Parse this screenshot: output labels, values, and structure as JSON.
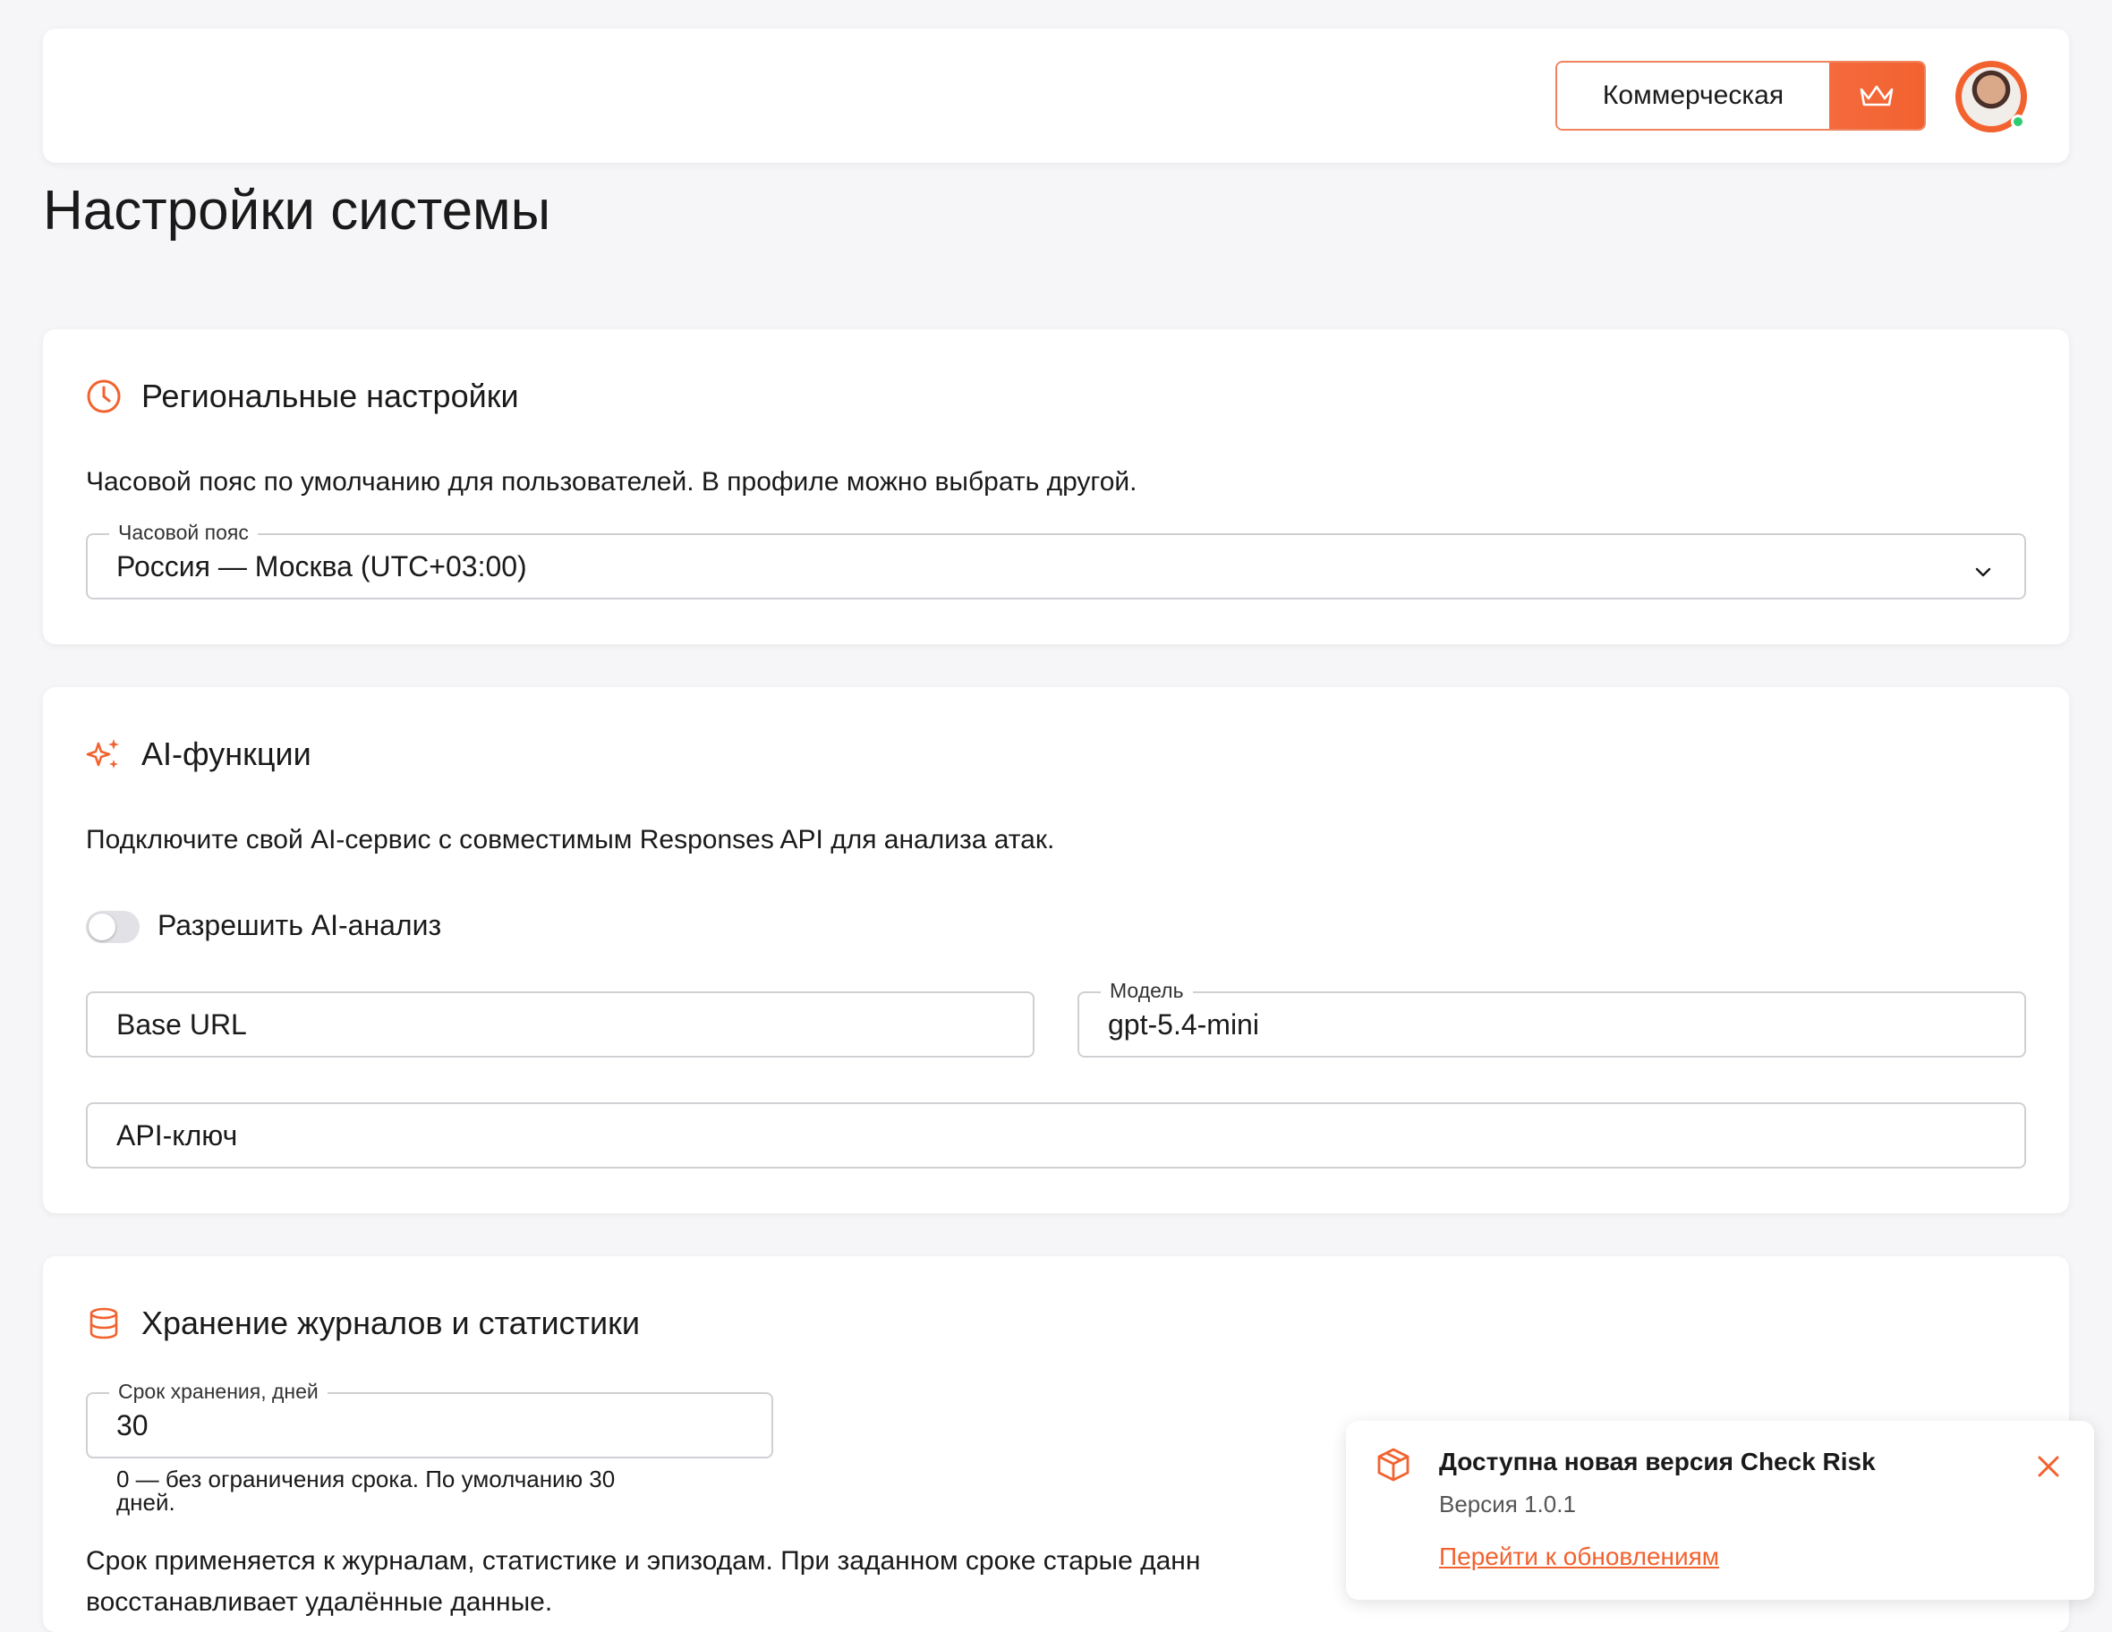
{
  "header": {
    "plan_label": "Коммерческая",
    "crown_icon": "crown-icon",
    "avatar": "user-avatar",
    "status": "online"
  },
  "page": {
    "title": "Настройки системы"
  },
  "regional": {
    "icon": "clock-icon",
    "title": "Региональные настройки",
    "description": "Часовой пояс по умолчанию для пользователей. В профиле можно выбрать другой.",
    "timezone_label": "Часовой пояс",
    "timezone_value": "Россия — Москва (UTC+03:00)"
  },
  "ai": {
    "icon": "sparkles-icon",
    "title": "AI-функции",
    "description": "Подключите свой AI-сервис с совместимым Responses API для анализа атак.",
    "toggle_label": "Разрешить AI-анализ",
    "toggle_on": false,
    "base_url_placeholder": "Base URL",
    "model_label": "Модель",
    "model_value": "gpt-5.4-mini",
    "api_key_placeholder": "API-ключ"
  },
  "storage": {
    "icon": "database-icon",
    "title": "Хранение журналов и статистики",
    "retention_label": "Срок хранения, дней",
    "retention_value": "30",
    "retention_hint_1": "0 — без ограничения срока. По умолчанию 30",
    "retention_hint_2": "дней.",
    "note_line_1": "Срок применяется к журналам, статистике и эпизодам. При заданном сроке старые данн",
    "note_line_2": "восстанавливает удалённые данные."
  },
  "toast": {
    "icon": "package-icon",
    "title": "Доступна новая версия Check Risk",
    "version": "Версия 1.0.1",
    "link": "Перейти к обновлениям",
    "close_icon": "close-icon"
  },
  "colors": {
    "accent": "#f2622f",
    "background": "#f6f6f8",
    "border": "#d0d0d4"
  }
}
